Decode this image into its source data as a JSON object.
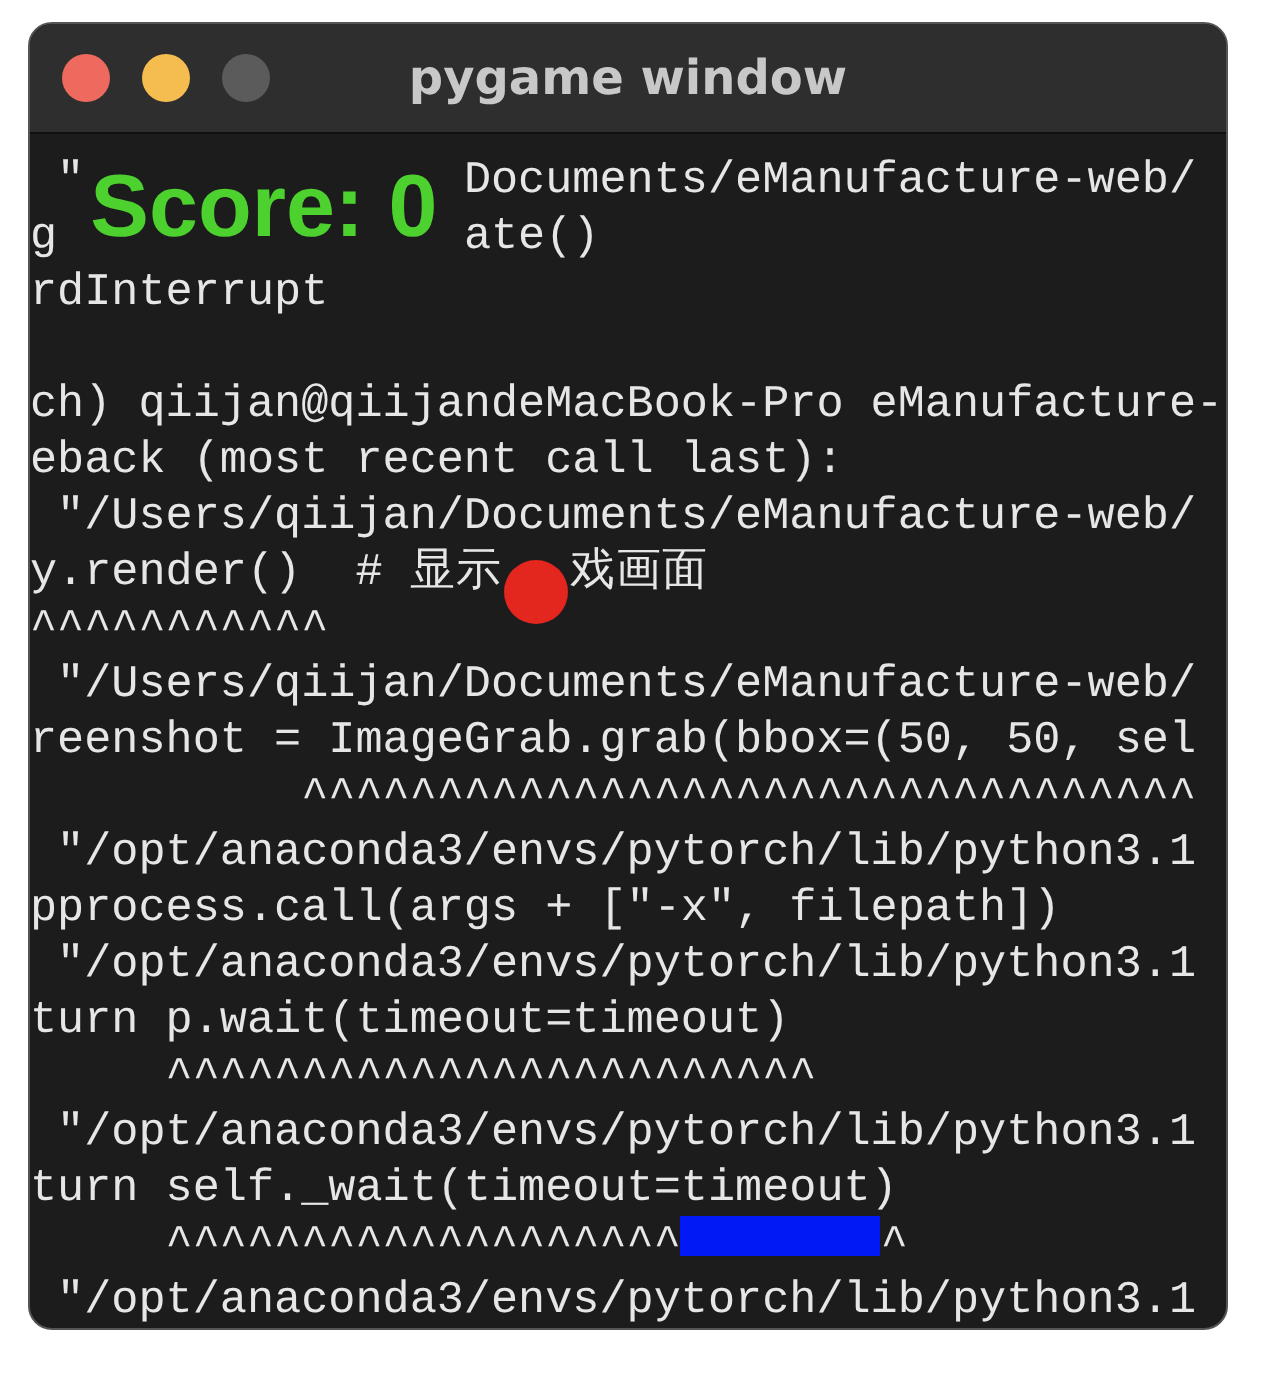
{
  "window": {
    "title": "pygame window",
    "controls": [
      {
        "kind": "close"
      },
      {
        "kind": "minimize"
      },
      {
        "kind": "zoom"
      }
    ]
  },
  "terminal": {
    "lines": [
      {
        "kind": "text",
        "parts": [
          {
            "kind": "text",
            "text": " \""
          },
          {
            "kind": "score",
            "text": "Score: 0"
          },
          {
            "kind": "text",
            "text": "Documents/eManufacture-web/"
          }
        ]
      },
      {
        "kind": "text",
        "parts": [
          {
            "kind": "text",
            "text": "g"
          },
          {
            "kind": "covered"
          },
          {
            "kind": "text",
            "text": "ate()"
          }
        ]
      },
      {
        "kind": "text",
        "parts": [
          {
            "kind": "text",
            "text": "rdInterrupt"
          }
        ]
      },
      {
        "kind": "blank"
      },
      {
        "kind": "text",
        "parts": [
          {
            "kind": "text",
            "text": "ch) qiijan@qiijandeMacBook-Pro eManufacture-"
          }
        ]
      },
      {
        "kind": "text",
        "parts": [
          {
            "kind": "text",
            "text": "eback (most recent call last):"
          }
        ]
      },
      {
        "kind": "text",
        "parts": [
          {
            "kind": "text",
            "text": " \"/Users/qiijan/Documents/eManufacture-web/"
          }
        ]
      },
      {
        "kind": "text",
        "parts": [
          {
            "kind": "text",
            "text": "y.render()  # 显示"
          },
          {
            "kind": "ball"
          },
          {
            "kind": "text",
            "text": "戏画面"
          }
        ]
      },
      {
        "kind": "text",
        "parts": [
          {
            "kind": "text",
            "text": "^^^^^^^^^^^"
          }
        ]
      },
      {
        "kind": "text",
        "parts": [
          {
            "kind": "text",
            "text": " \"/Users/qiijan/Documents/eManufacture-web/"
          }
        ]
      },
      {
        "kind": "text",
        "parts": [
          {
            "kind": "text",
            "text": "reenshot = ImageGrab.grab(bbox=(50, 50, sel"
          }
        ]
      },
      {
        "kind": "text",
        "parts": [
          {
            "kind": "text",
            "text": "          ^^^^^^^^^^^^^^^^^^^^^^^^^^^^^^^^^"
          }
        ]
      },
      {
        "kind": "text",
        "parts": [
          {
            "kind": "text",
            "text": " \"/opt/anaconda3/envs/pytorch/lib/python3.1"
          }
        ]
      },
      {
        "kind": "text",
        "parts": [
          {
            "kind": "text",
            "text": "pprocess.call(args + [\"-x\", filepath])"
          }
        ]
      },
      {
        "kind": "text",
        "parts": [
          {
            "kind": "text",
            "text": " \"/opt/anaconda3/envs/pytorch/lib/python3.1"
          }
        ]
      },
      {
        "kind": "text",
        "parts": [
          {
            "kind": "text",
            "text": "turn p.wait(timeout=timeout)"
          }
        ]
      },
      {
        "kind": "text",
        "parts": [
          {
            "kind": "text",
            "text": "     ^^^^^^^^^^^^^^^^^^^^^^^^"
          }
        ]
      },
      {
        "kind": "text",
        "parts": [
          {
            "kind": "text",
            "text": " \"/opt/anaconda3/envs/pytorch/lib/python3.1"
          }
        ]
      },
      {
        "kind": "text",
        "parts": [
          {
            "kind": "text",
            "text": "turn self._wait(timeout=timeout)"
          }
        ]
      },
      {
        "kind": "text",
        "parts": [
          {
            "kind": "text",
            "text": "     ^^^^^^^^^^^^^^^^^^^"
          },
          {
            "kind": "paddle"
          },
          {
            "kind": "text",
            "text": "^"
          }
        ]
      },
      {
        "kind": "text",
        "parts": [
          {
            "kind": "text",
            "text": " \"/opt/anaconda3/envs/pytorch/lib/python3.1"
          }
        ]
      }
    ]
  }
}
